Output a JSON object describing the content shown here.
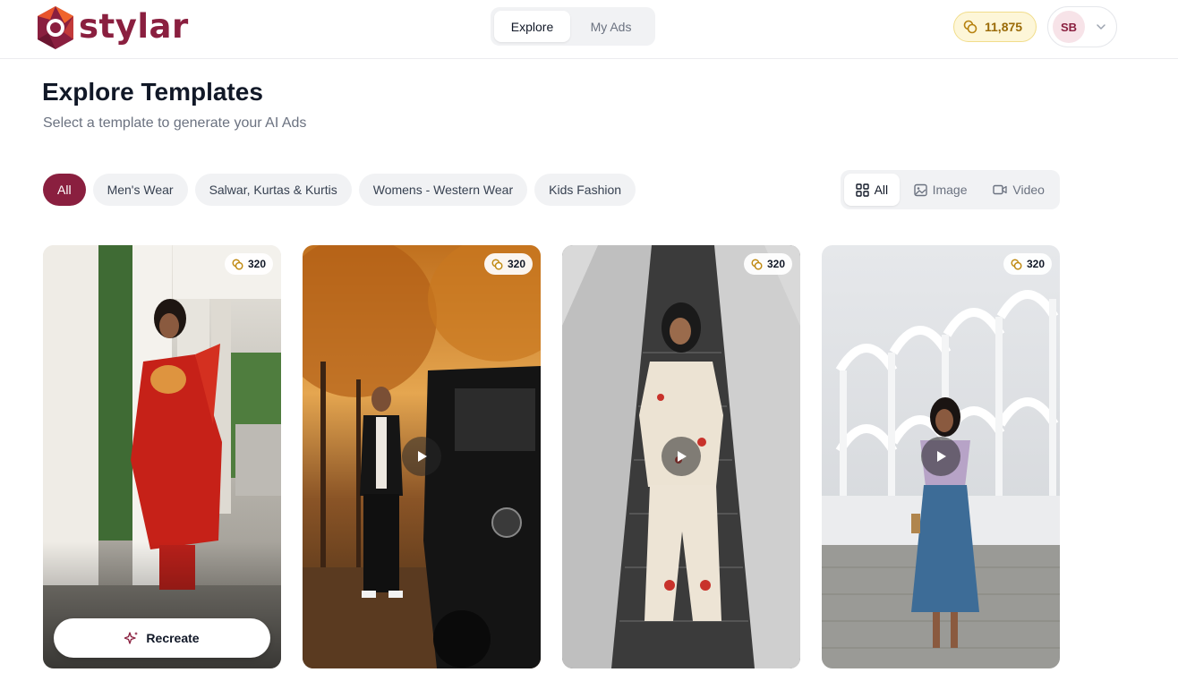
{
  "brand": {
    "name": "stylar",
    "color": "#8a1f3f"
  },
  "nav": {
    "tabs": [
      {
        "label": "Explore",
        "active": true
      },
      {
        "label": "My Ads",
        "active": false
      }
    ]
  },
  "credits": {
    "amount": "11,875",
    "icon": "coin-icon"
  },
  "account": {
    "initials": "SB",
    "menu_icon": "chevron-down-icon"
  },
  "page": {
    "title": "Explore Templates",
    "subtitle": "Select a template to generate your AI Ads"
  },
  "filters": {
    "categories": [
      {
        "label": "All",
        "active": true
      },
      {
        "label": "Men's Wear",
        "active": false
      },
      {
        "label": "Salwar, Kurtas & Kurtis",
        "active": false
      },
      {
        "label": "Womens - Western Wear",
        "active": false
      },
      {
        "label": "Kids Fashion",
        "active": false
      }
    ],
    "media": [
      {
        "label": "All",
        "icon": "grid-icon",
        "active": true
      },
      {
        "label": "Image",
        "icon": "image-icon",
        "active": false
      },
      {
        "label": "Video",
        "icon": "video-icon",
        "active": false
      }
    ]
  },
  "templates": [
    {
      "cost": "320",
      "type": "image",
      "action_label": "Recreate",
      "scene": "woman in red kurta among white pillars"
    },
    {
      "cost": "320",
      "type": "video",
      "scene": "man in black jacket beside black SUV in autumn street"
    },
    {
      "cost": "320",
      "type": "video",
      "scene": "woman in floral co-ord set on escalator"
    },
    {
      "cost": "320",
      "type": "video",
      "scene": "woman in lilac top and denim skirt in front of white arches"
    }
  ]
}
